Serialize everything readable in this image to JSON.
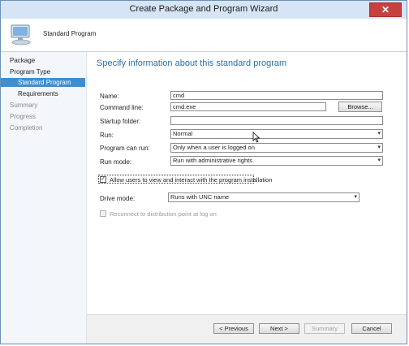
{
  "window": {
    "title": "Create Package and Program Wizard",
    "close_glyph": "✕"
  },
  "header": {
    "title": "Standard Program",
    "icon": "computer-icon"
  },
  "sidebar": {
    "items": [
      {
        "label": "Package"
      },
      {
        "label": "Program Type"
      },
      {
        "label": "Standard Program"
      },
      {
        "label": "Requirements"
      },
      {
        "label": "Summary"
      },
      {
        "label": "Progress"
      },
      {
        "label": "Completion"
      }
    ]
  },
  "main": {
    "heading": "Specify information about this standard program",
    "name_label": "Name:",
    "name_value": "cmd",
    "command_label": "Command line:",
    "command_value": "cmd.exe",
    "browse_label": "Browse...",
    "startup_label": "Startup folder:",
    "startup_value": "",
    "run_label": "Run:",
    "run_value": "Normal",
    "can_run_label": "Program can run:",
    "can_run_value": "Only when a user is logged on",
    "run_mode_label": "Run mode:",
    "run_mode_value": "Run with administrative rights",
    "allow_interact_label": "Allow users to view and interact with the program installation",
    "allow_interact_checked": true,
    "drive_mode_label": "Drive mode:",
    "drive_mode_value": "Runs with UNC name",
    "reconnect_label": "Reconnect to distribution point at log on",
    "reconnect_checked": false
  },
  "footer": {
    "previous_label": "< Previous",
    "next_label": "Next >",
    "summary_label": "Summary",
    "cancel_label": "Cancel"
  },
  "glyphs": {
    "dropdown": "▾",
    "check": "✓"
  },
  "colors": {
    "accent": "#3e8ed0",
    "heading": "#2f6ea5",
    "titlebar": "#d6e5f5",
    "close": "#c74040"
  }
}
